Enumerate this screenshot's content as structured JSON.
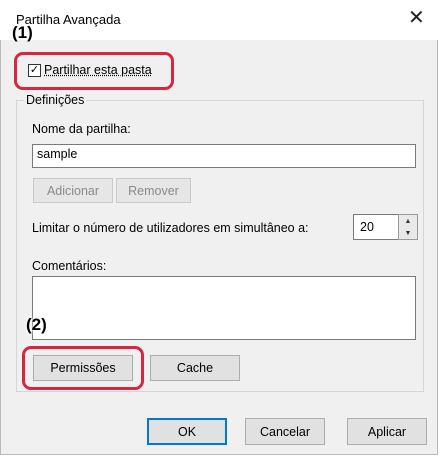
{
  "window": {
    "title": "Partilha Avançada",
    "close_glyph": "✕"
  },
  "annotations": {
    "callout1": "(1)",
    "callout2": "(2)"
  },
  "share_checkbox": {
    "label": "Partilhar esta pasta",
    "checked": true
  },
  "settings": {
    "group_label": "Definições",
    "share_name_label": "Nome da partilha:",
    "share_name_value": "sample",
    "add_label": "Adicionar",
    "remove_label": "Remover",
    "limit_label": "Limitar o número de utilizadores em simultâneo a:",
    "limit_value": "20",
    "comments_label": "Comentários:",
    "comments_value": "",
    "permissions_label": "Permissões",
    "cache_label": "Cache"
  },
  "footer": {
    "ok_label": "OK",
    "cancel_label": "Cancelar",
    "apply_label": "Aplicar"
  },
  "colors": {
    "callout": "#d9263f",
    "default_button_border": "#0078d7"
  }
}
